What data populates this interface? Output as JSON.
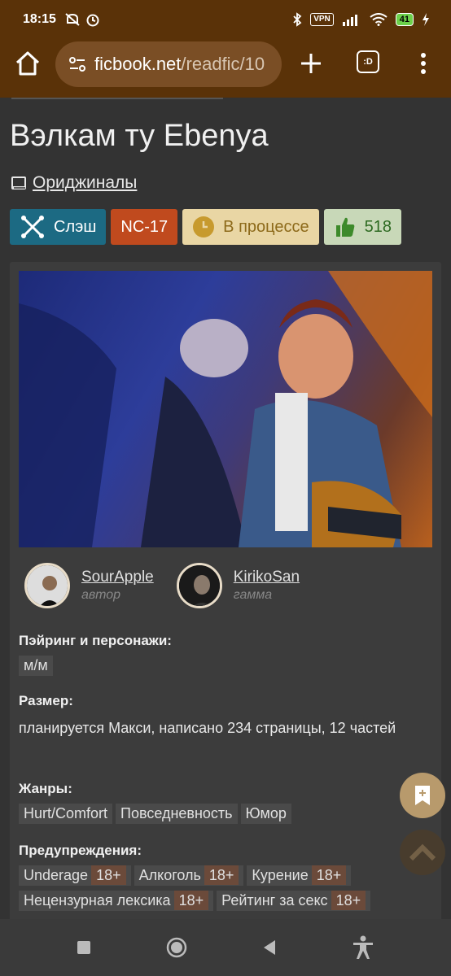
{
  "status_bar": {
    "time": "18:15",
    "vpn": "VPN",
    "battery": "41"
  },
  "browser": {
    "url_domain": "ficbook.net",
    "url_path": "/readfic/10",
    "tabs_label": ":D"
  },
  "story": {
    "title": "Вэлкам ту Ebenya",
    "fandom": "Ориджиналы",
    "badges": {
      "direction": "Слэш",
      "rating": "NC-17",
      "status": "В процессе",
      "likes": "518"
    }
  },
  "authors": [
    {
      "name": "SourApple",
      "role": "автор"
    },
    {
      "name": "KirikoSan",
      "role": "гамма"
    }
  ],
  "pairing": {
    "title": "Пэйринг и персонажи:",
    "tags": [
      "м/м"
    ]
  },
  "size": {
    "title": "Размер:",
    "text": "планируется Макси, написано 234 страницы, 12 частей"
  },
  "genres": {
    "title": "Жанры:",
    "tags": [
      "Hurt/Comfort",
      "Повседневность",
      "Юмор"
    ]
  },
  "warnings": {
    "title": "Предупреждения:",
    "tags": [
      {
        "label": "Underage",
        "age": "18+"
      },
      {
        "label": "Алкоголь",
        "age": "18+"
      },
      {
        "label": "Курение",
        "age": "18+"
      },
      {
        "label": "Нецензурная лексика",
        "age": "18+"
      },
      {
        "label": "Рейтинг за секс",
        "age": "18+"
      }
    ]
  },
  "colors": {
    "chrome": "#5a3208",
    "slash": "#1c6a83",
    "rating": "#c04a1e",
    "status": "#e9d6a4",
    "likes": "#c8d8b8"
  }
}
